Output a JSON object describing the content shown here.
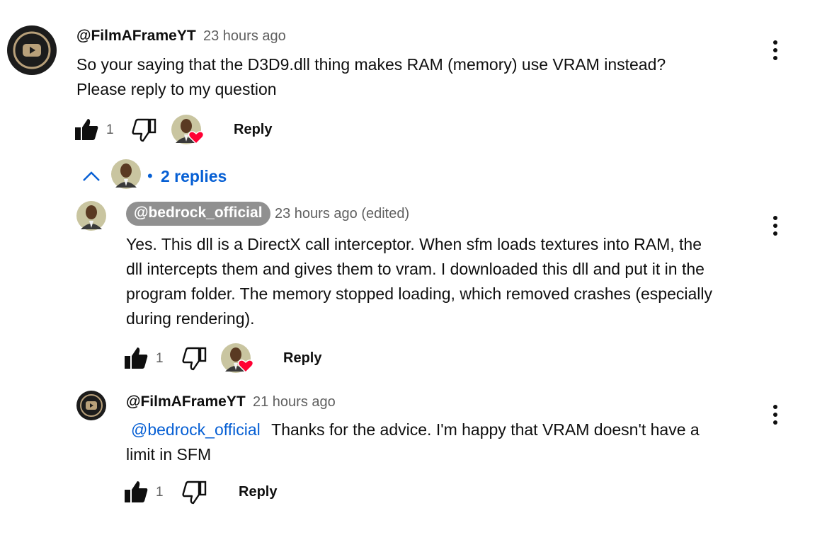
{
  "comment": {
    "author": "@FilmAFrameYT",
    "time": "23 hours ago",
    "text_line1": "So your saying that the D3D9.dll thing makes RAM (memory) use VRAM instead?",
    "text_line2": "Please reply to my question",
    "like_count": "1",
    "reply_label": "Reply"
  },
  "replies_toggle": {
    "label": "2 replies",
    "separator": "•"
  },
  "replies": [
    {
      "author": "@bedrock_official",
      "time": "23 hours ago (edited)",
      "text_line1": "Yes. This dll is a DirectX call interceptor. When sfm loads textures into RAM, the",
      "text_line2": "dll intercepts them and gives them to vram. I downloaded this dll and put it in the",
      "text_line3": "program folder. The memory stopped loading, which removed crashes (especially",
      "text_line4": "during rendering).",
      "like_count": "1",
      "reply_label": "Reply"
    },
    {
      "author": "@FilmAFrameYT",
      "time": "21 hours ago",
      "mention": "@bedrock_official",
      "text_line1_rest": "Thanks for the advice. I'm happy that VRAM doesn't have a",
      "text_line2": "limit in SFM",
      "like_count": "1",
      "reply_label": "Reply"
    }
  ],
  "colors": {
    "link_blue": "#065fd4",
    "heart_red": "#ff0033",
    "avatar_dark": "#1c1c1c",
    "avatar_gold": "#b8a07a",
    "chip_gray": "#909090"
  }
}
